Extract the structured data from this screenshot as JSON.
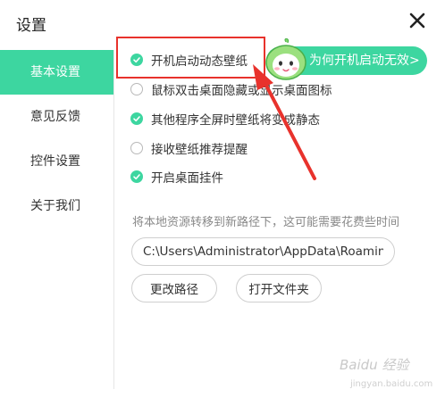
{
  "window": {
    "title": "设置"
  },
  "sidebar": {
    "items": [
      {
        "label": "基本设置"
      },
      {
        "label": "意见反馈"
      },
      {
        "label": "控件设置"
      },
      {
        "label": "关于我们"
      }
    ]
  },
  "options": [
    {
      "label": "开机启动动态壁纸",
      "checked": true
    },
    {
      "label": "鼠标双击桌面隐藏或显示桌面图标",
      "checked": false
    },
    {
      "label": "其他程序全屏时壁纸将变成静态",
      "checked": true
    },
    {
      "label": "接收壁纸推荐提醒",
      "checked": false
    },
    {
      "label": "开启桌面挂件",
      "checked": true
    }
  ],
  "help_badge": {
    "label": "为何开机启动无效>"
  },
  "storage": {
    "hint": "将本地资源转移到新路径下，这可能需要花费些时间",
    "path": "C:\\Users\\Administrator\\AppData\\Roaming",
    "change_label": "更改路径",
    "open_label": "打开文件夹"
  },
  "watermark": {
    "text": "Baidu 经验",
    "sub": "jingyan.baidu.com"
  },
  "colors": {
    "accent": "#3dd6a0",
    "annotation": "#e8322c"
  }
}
